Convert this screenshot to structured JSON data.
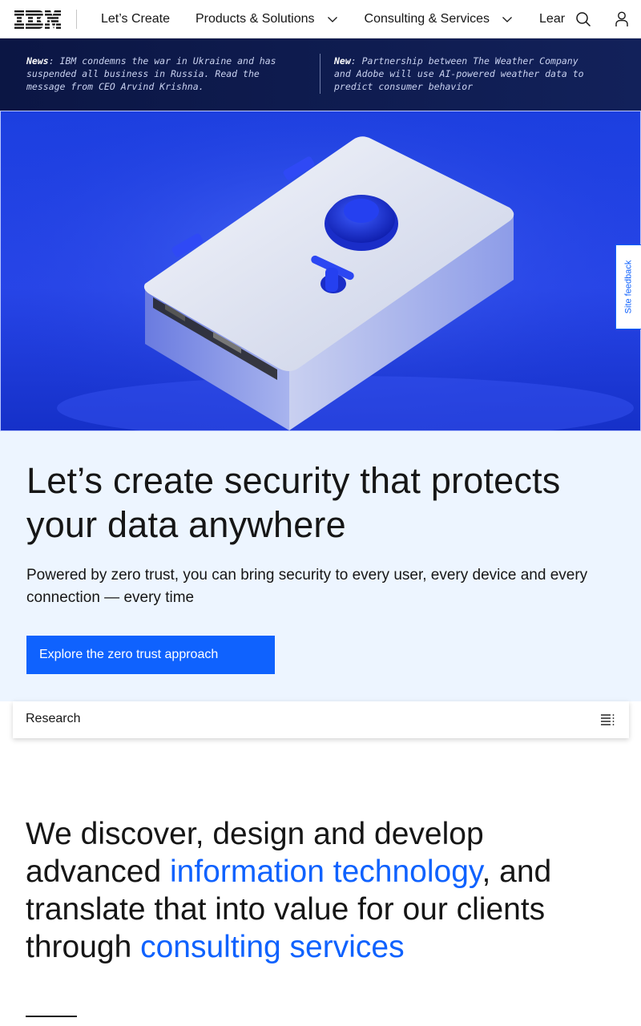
{
  "masthead": {
    "logo_text": "IBM",
    "nav": [
      {
        "label": "Let’s Create",
        "has_menu": false
      },
      {
        "label": "Products & Solutions",
        "has_menu": true
      },
      {
        "label": "Consulting & Services",
        "has_menu": true
      },
      {
        "label": "Learn",
        "has_menu": false
      }
    ],
    "icons": [
      "search-icon",
      "user-icon",
      "chevron-down-icon"
    ]
  },
  "news": [
    {
      "tag": "News",
      "text": ": IBM condemns the war in Ukraine and has suspended all business in Russia. Read the message from CEO Arvind Krishna."
    },
    {
      "tag": "New",
      "text": ": Partnership between The Weather Company and Adobe will use AI-powered weather data to predict consumer behavior"
    }
  ],
  "feedback": {
    "label": "Site feedback"
  },
  "lead": {
    "title": "Let’s create security that protects your data anywhere",
    "description": "Powered by zero trust, you can bring security to every user, every device and every connection — every time",
    "cta_label": "Explore the zero trust approach"
  },
  "toc": {
    "label": "Research"
  },
  "statement": {
    "part1": "We discover, design and develop advanced ",
    "link1": "information technology",
    "part2": ", and translate that into value for our clients through ",
    "link2": "consulting services"
  },
  "colors": {
    "accent": "#0f62fe",
    "banner_bg": "#0f1b4a",
    "lead_bg": "#edf5ff",
    "text": "#161616"
  }
}
